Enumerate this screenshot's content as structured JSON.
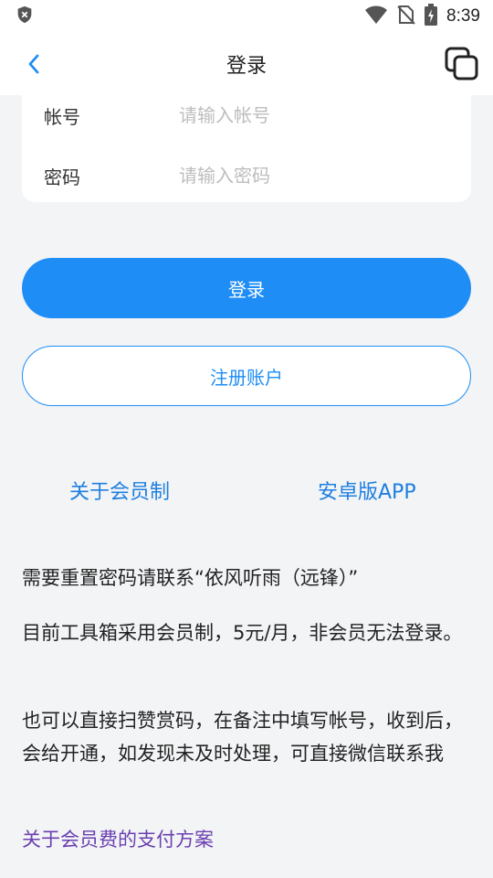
{
  "status_bar": {
    "time": "8:39",
    "icons": [
      "shield-x-icon",
      "wifi-icon",
      "no-sim-icon",
      "battery-charging-icon"
    ]
  },
  "app_bar": {
    "title": "登录",
    "back_icon": "chevron-left-icon",
    "action_icon": "copy-icon"
  },
  "form": {
    "account_label": "帐号",
    "account_placeholder": "请输入帐号",
    "account_value": "",
    "password_label": "密码",
    "password_placeholder": "请输入密码",
    "password_value": ""
  },
  "buttons": {
    "login": "登录",
    "register": "注册账户"
  },
  "links": {
    "membership": "关于会员制",
    "android_app": "安卓版APP"
  },
  "notes": {
    "reset_password": "需要重置密码请联系“依风听雨（远锋）”",
    "membership_info": "目前工具箱采用会员制，5元/月，非会员无法登录。",
    "reward_info": "也可以直接扫赞赏码，在备注中填写帐号，收到后，会给开通，如发现未及时处理，可直接微信联系我",
    "payment_link": "关于会员费的支付方案"
  },
  "colors": {
    "primary": "#1e8df5",
    "link": "#1e7fe0",
    "payment_link": "#6a3fb0",
    "background": "#f3f4f6"
  }
}
